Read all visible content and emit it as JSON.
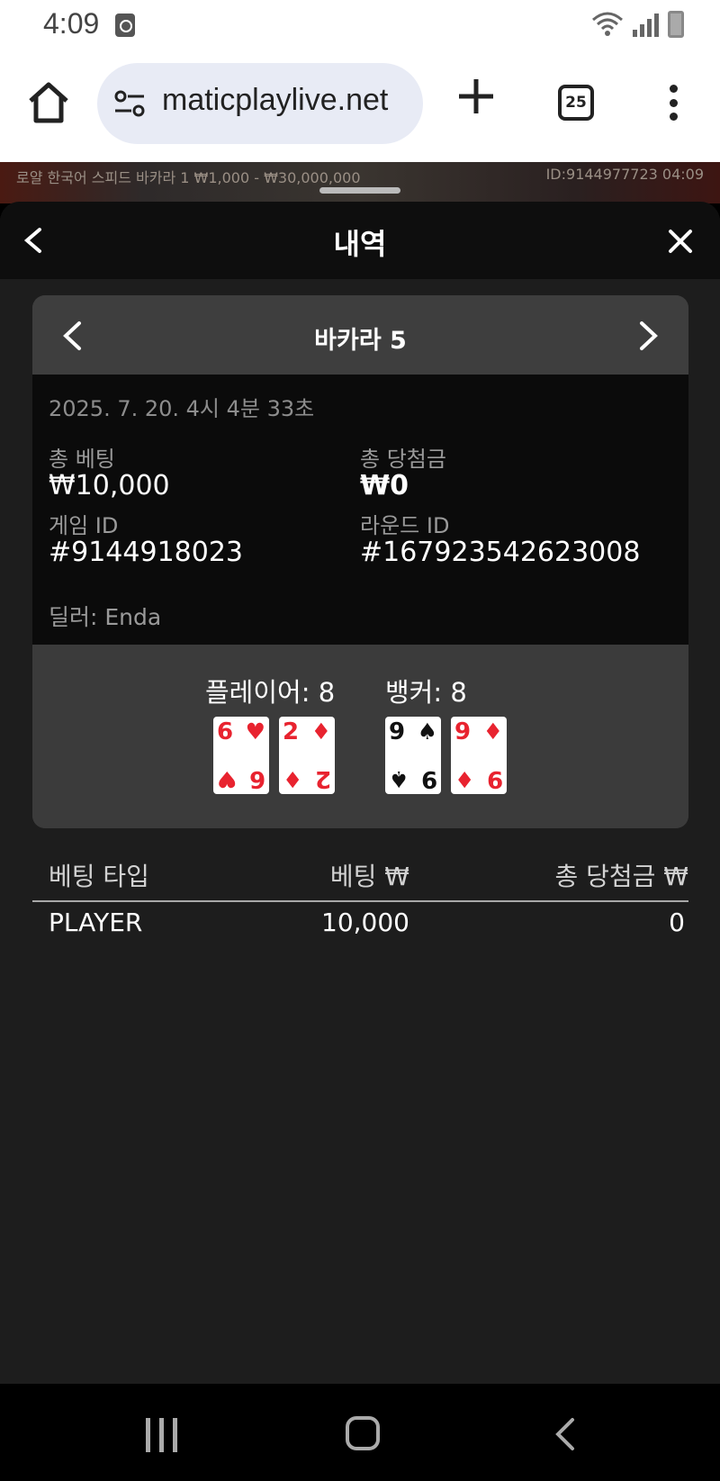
{
  "status_bar": {
    "time": "4:09"
  },
  "browser": {
    "url": "maticplaylive.net",
    "tab_count": "25"
  },
  "game_strip": {
    "left_text": "로얄 한국어 스피드 바카라 1  ₩1,000 - ₩30,000,000",
    "right_text": "ID:9144977723  04:09"
  },
  "modal": {
    "title": "내역",
    "card_title": "바카라 5",
    "date": "2025. 7. 20. 4시 4분 33초",
    "total_bet_label": "총 베팅",
    "total_bet_value": "₩10,000",
    "total_win_label": "총 당첨금",
    "total_win_value": "₩0",
    "game_id_label": "게임 ID",
    "game_id_value": "#9144918023",
    "round_id_label": "라운드 ID",
    "round_id_value": "#167923542623008",
    "dealer": "딜러: Enda",
    "player_label": "플레이어: 8",
    "banker_label": "뱅커: 8",
    "player_cards": [
      {
        "rank": "6",
        "suit": "♥",
        "color": "#e8232f"
      },
      {
        "rank": "2",
        "suit": "♦",
        "color": "#e8232f"
      }
    ],
    "banker_cards": [
      {
        "rank": "9",
        "suit": "♠",
        "color": "#111111"
      },
      {
        "rank": "9",
        "suit": "♦",
        "color": "#e8232f"
      }
    ]
  },
  "bet_table": {
    "headers": [
      "베팅 타입",
      "베팅 ₩",
      "총 당첨금 ₩"
    ],
    "rows": [
      [
        "PLAYER",
        "10,000",
        "0"
      ]
    ]
  }
}
